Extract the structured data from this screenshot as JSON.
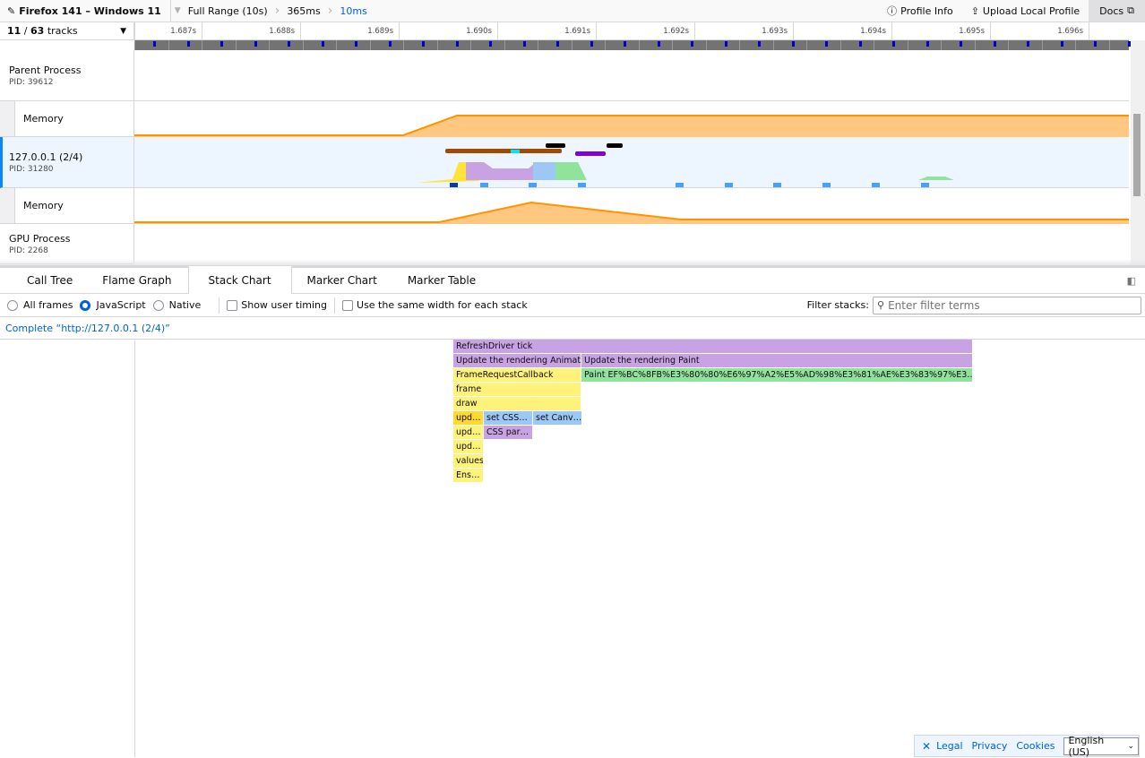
{
  "topbar": {
    "title": "Firefox 141 – Windows 11",
    "breadcrumbs": [
      "Full Range (10s)",
      "365ms",
      "10ms"
    ],
    "profile_info": "Profile Info",
    "upload": "Upload Local Profile",
    "docs": "Docs"
  },
  "tracks": {
    "visible": "11",
    "sep": " / ",
    "total": "63",
    "suffix": " tracks",
    "items": [
      {
        "name": "Parent Process",
        "pid": "PID: 39612"
      },
      {
        "name": "Memory",
        "pid": ""
      },
      {
        "name": "127.0.0.1 (2/4)",
        "pid": "PID: 31280"
      },
      {
        "name": "Memory",
        "pid": ""
      },
      {
        "name": "GPU Process",
        "pid": "PID: 2268"
      }
    ]
  },
  "ruler": {
    "ticks": [
      "1.687s",
      "1.688s",
      "1.689s",
      "1.690s",
      "1.691s",
      "1.692s",
      "1.693s",
      "1.694s",
      "1.695s",
      "1.696s"
    ]
  },
  "tabs": [
    "Call Tree",
    "Flame Graph",
    "Stack Chart",
    "Marker Chart",
    "Marker Table"
  ],
  "active_tab": "Stack Chart",
  "settings": {
    "all_frames": "All frames",
    "javascript": "JavaScript",
    "native": "Native",
    "selected": "JavaScript",
    "show_user_timing": "Show user timing",
    "same_width": "Use the same width for each stack",
    "filter_label": "Filter stacks:",
    "filter_placeholder": "Enter filter terms"
  },
  "thread_status": "Complete “http://127.0.0.1 (2/4)”",
  "stack_frames": {
    "row0": [
      "RefreshDriver tick"
    ],
    "row1": [
      "Update the rendering Animat…",
      "Update the rendering Paint"
    ],
    "row2": [
      "FrameRequestCallback",
      "Paint EF%BC%8FB%E3%80%80%E6%97%A2%E5%AD%98%E3%81%AE%E3%83%97%E3…"
    ],
    "row3": [
      "frame"
    ],
    "row4": [
      "draw"
    ],
    "row5": [
      "upd…",
      "set CSS…",
      "set Canv…"
    ],
    "row6": [
      "upd…",
      "CSS par…"
    ],
    "row7": [
      "upd…"
    ],
    "row8": [
      "values"
    ],
    "row9": [
      "Ens…"
    ]
  },
  "colors": {
    "purple": "#c9a2e3",
    "yellow": "#fff27a",
    "blue": "#9cc8f5",
    "green": "#90e39a",
    "orange": "#ff9400",
    "accent": "#0060df"
  },
  "footer": {
    "legal": "Legal",
    "privacy": "Privacy",
    "cookies": "Cookies",
    "language": "English (US)"
  }
}
